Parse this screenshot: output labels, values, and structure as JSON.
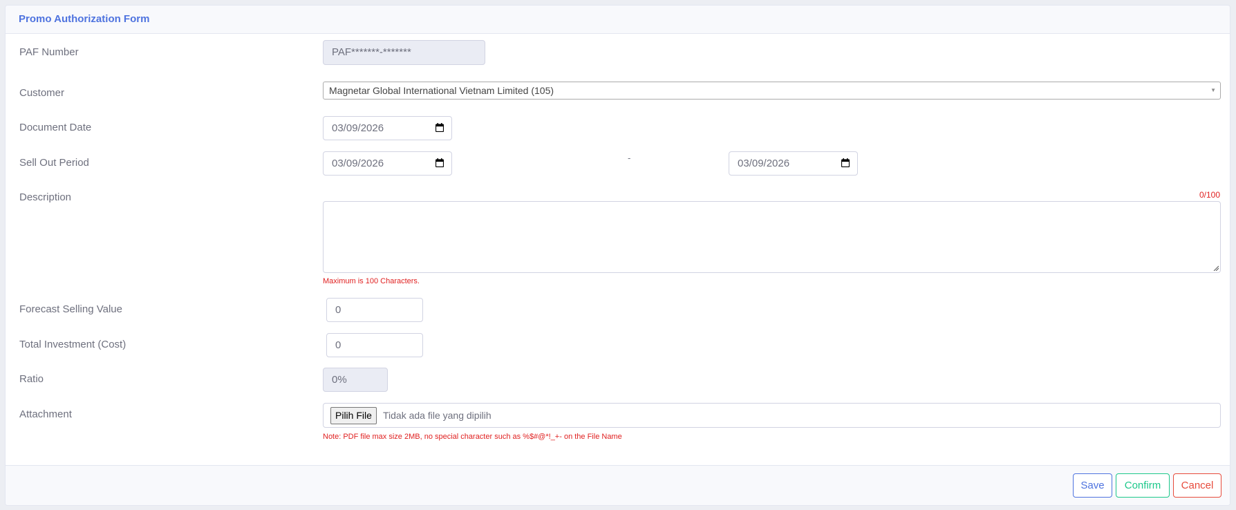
{
  "form": {
    "title": "Promo Authorization Form",
    "fields": {
      "paf_number": {
        "label": "PAF Number",
        "value": "PAF*******-*******"
      },
      "customer": {
        "label": "Customer",
        "value": "Magnetar Global International Vietnam Limited (105)"
      },
      "document_date": {
        "label": "Document Date",
        "value": "03/09/2026"
      },
      "sell_out_period": {
        "label": "Sell Out Period",
        "from": "03/09/2026",
        "separator": "-",
        "to": "03/09/2026"
      },
      "description": {
        "label": "Description",
        "value": "",
        "counter": "0/100",
        "hint": "Maximum is 100 Characters."
      },
      "forecast_selling_value": {
        "label": "Forecast Selling Value",
        "value": "0"
      },
      "total_investment": {
        "label": "Total Investment (Cost)",
        "value": "0"
      },
      "ratio": {
        "label": "Ratio",
        "value": "0%"
      },
      "attachment": {
        "label": "Attachment",
        "button": "Pilih File",
        "status": "Tidak ada file yang dipilih",
        "note": "Note: PDF file max size 2MB, no special character such as %$#@*!_+- on the File Name"
      }
    }
  },
  "footer": {
    "save": "Save",
    "confirm": "Confirm",
    "cancel": "Cancel"
  },
  "colors": {
    "primary": "#4e73df",
    "success": "#1cc88a",
    "danger": "#e74a3b",
    "error_text": "#e02020"
  },
  "icons": {
    "calendar": "calendar-icon",
    "dropdown": "chevron-down-icon"
  }
}
